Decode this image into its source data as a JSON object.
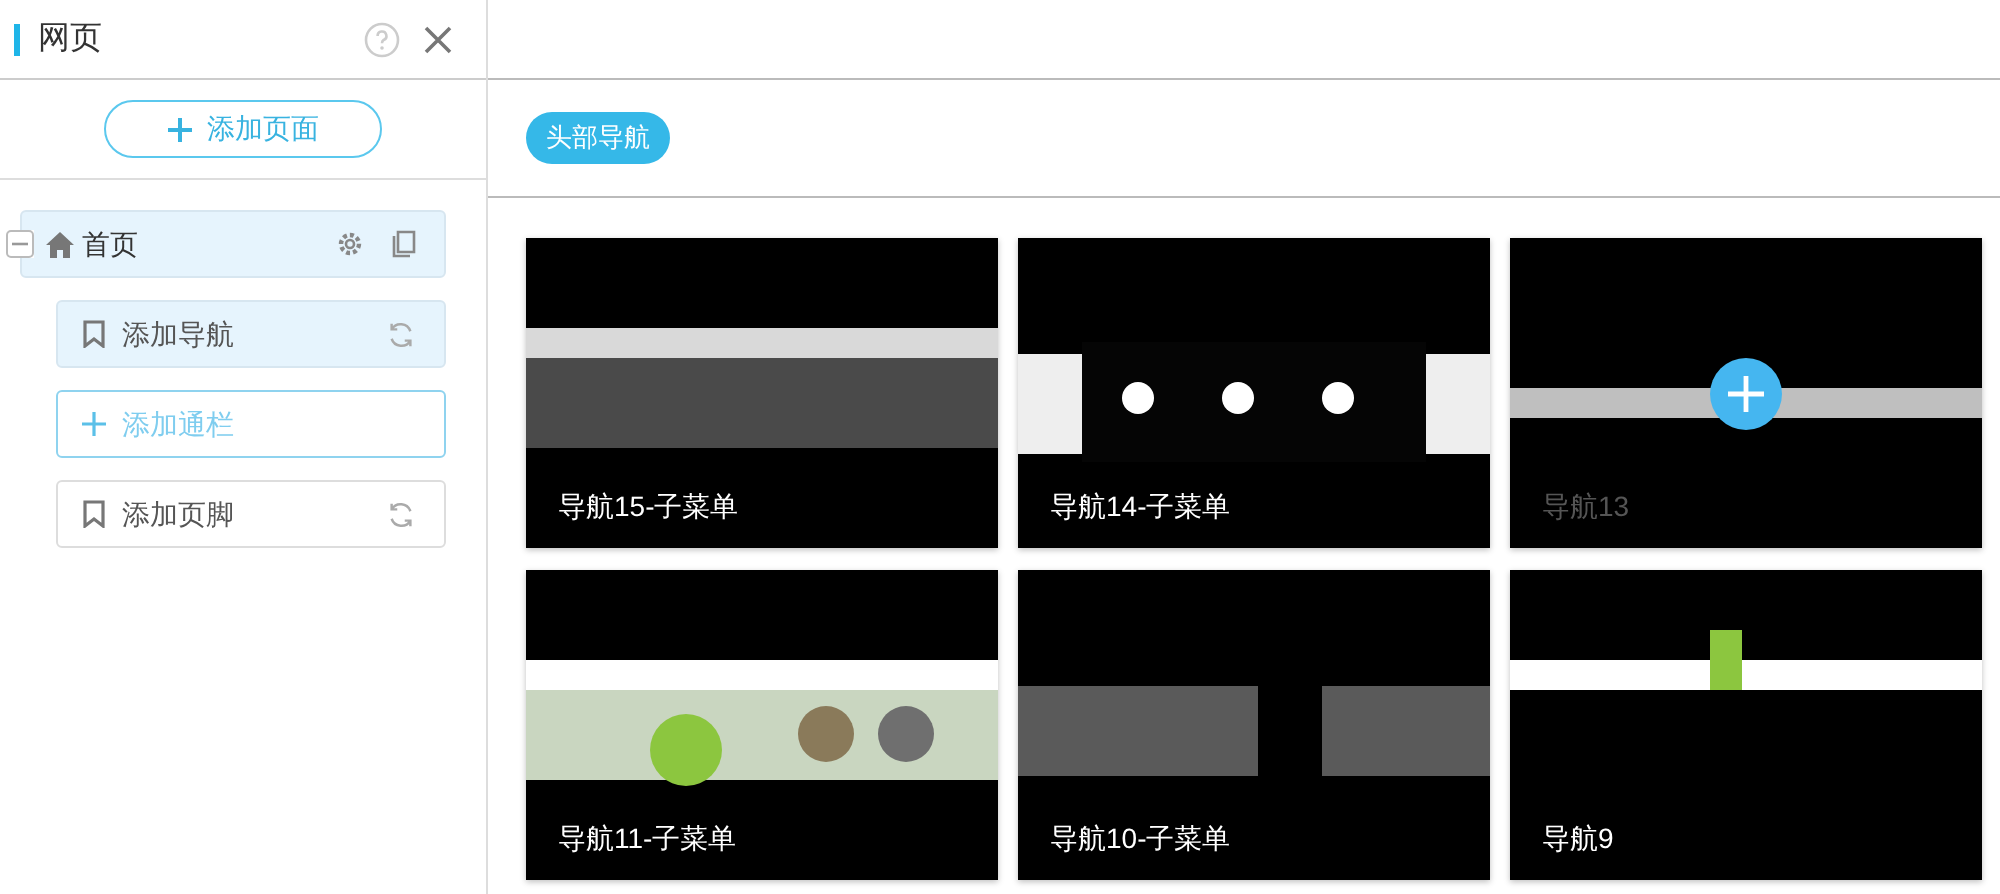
{
  "sidebar": {
    "title": "网页",
    "add_page_button": "添加页面",
    "tree": [
      {
        "label": "首页",
        "expanded": true,
        "selected": true,
        "children": [
          {
            "label": "添加导航",
            "kind": "section",
            "selected": true
          },
          {
            "label": "添加通栏",
            "kind": "add",
            "selected": false
          },
          {
            "label": "添加页脚",
            "kind": "section",
            "selected": false
          }
        ]
      }
    ]
  },
  "main": {
    "tags": [
      {
        "label": "头部导航",
        "selected": true
      }
    ],
    "templates": [
      {
        "label": "导航15-子菜单",
        "hovered": false
      },
      {
        "label": "导航14-子菜单",
        "hovered": false
      },
      {
        "label": "导航13",
        "hovered": true
      },
      {
        "label": "导航11-子菜单",
        "hovered": false
      },
      {
        "label": "导航10-子菜单",
        "hovered": false
      },
      {
        "label": "导航9",
        "hovered": false
      }
    ]
  }
}
